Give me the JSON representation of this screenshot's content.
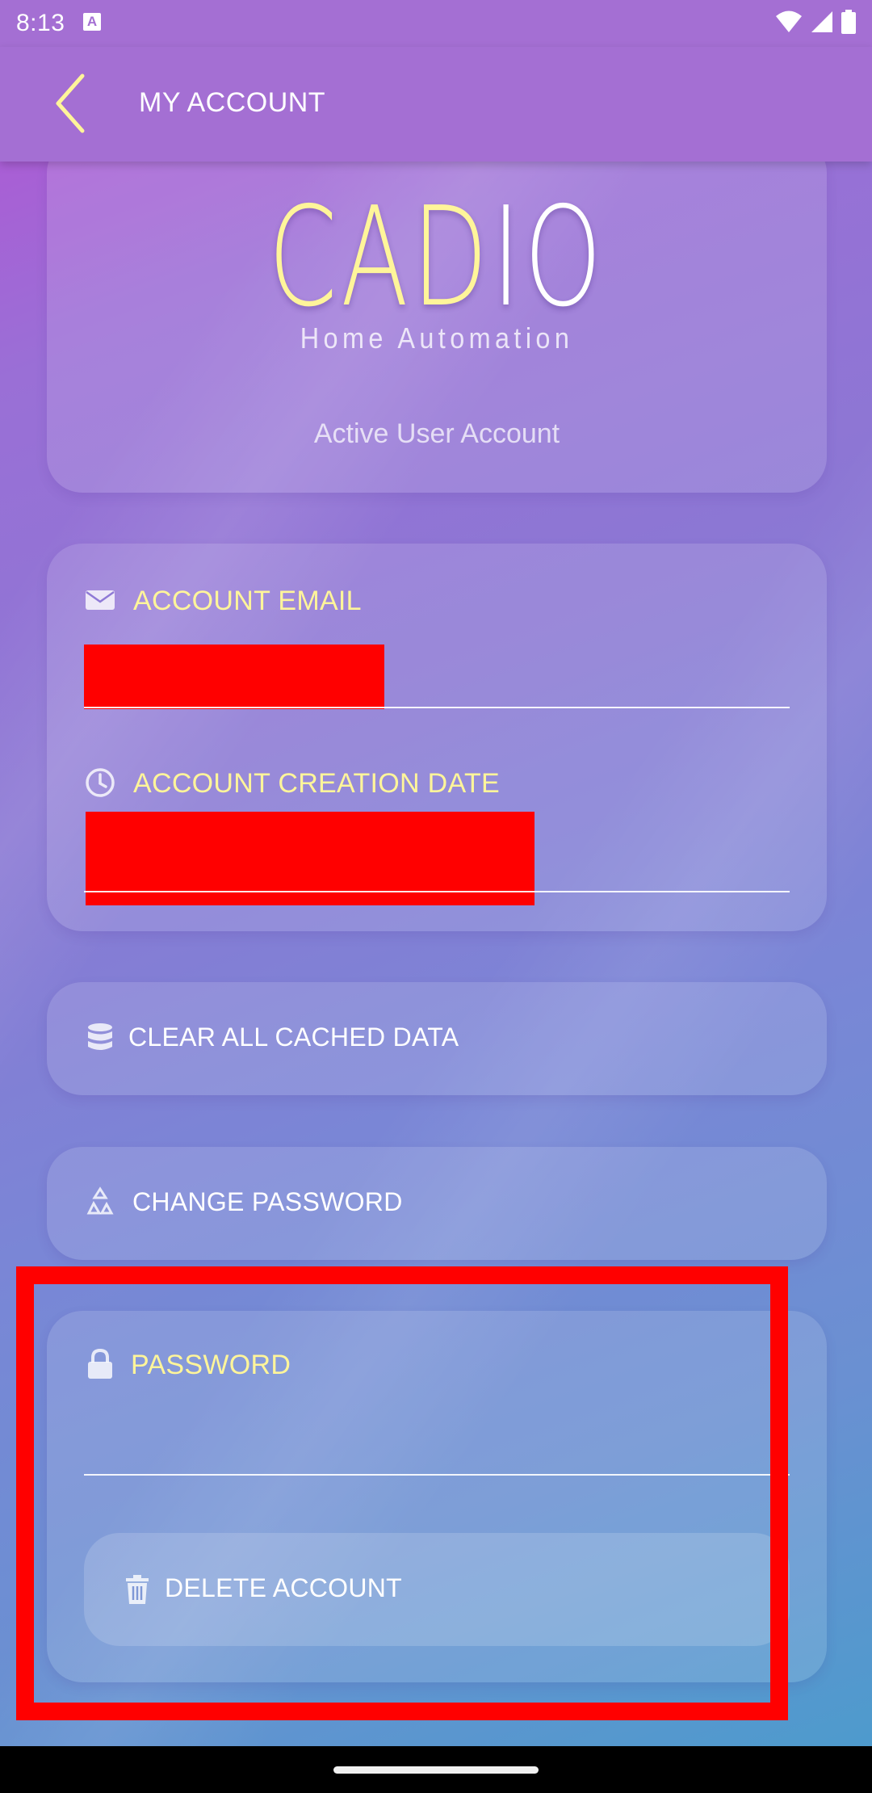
{
  "status_bar": {
    "time": "8:13",
    "notification_glyph": "A"
  },
  "app_bar": {
    "title": "MY ACCOUNT"
  },
  "header_card": {
    "logo_part1": "CAD",
    "logo_part2": "IO",
    "tagline": "Home Automation",
    "status": "Active User Account"
  },
  "account_info": {
    "email_label": "ACCOUNT EMAIL",
    "creation_date_label": "ACCOUNT CREATION DATE"
  },
  "actions": {
    "clear_cache_label": "CLEAR ALL CACHED DATA",
    "change_password_label": "CHANGE PASSWORD"
  },
  "delete_section": {
    "password_label": "PASSWORD",
    "password_value": "",
    "delete_label": "DELETE ACCOUNT"
  },
  "colors": {
    "app_bar": "#a46fd3",
    "label_accent": "#fff59a",
    "highlight_box": "#ff0000"
  },
  "icons": [
    "back-chevron-icon",
    "envelope-icon",
    "clock-icon",
    "database-icon",
    "recycle-icon",
    "lock-icon",
    "trash-icon",
    "wifi-icon",
    "signal-icon",
    "battery-icon"
  ]
}
